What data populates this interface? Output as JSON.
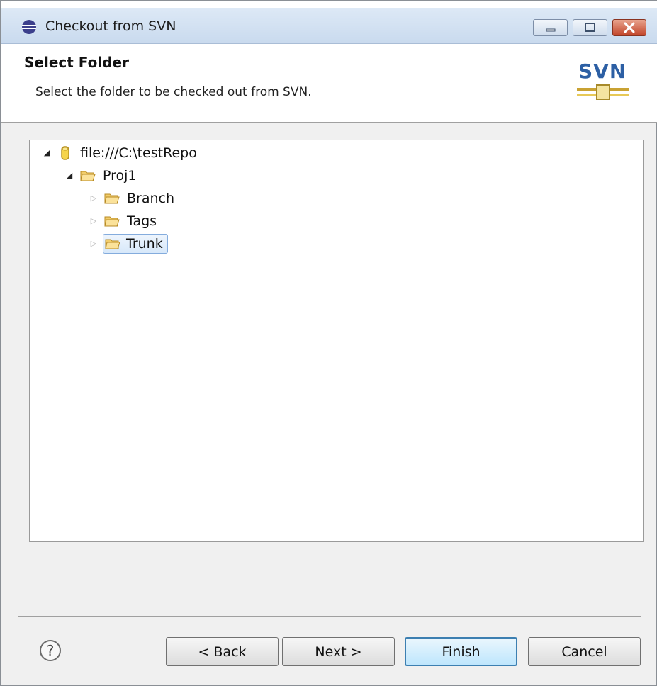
{
  "window": {
    "title": "Checkout from SVN",
    "controls": {
      "minimize_icon": "minimize-icon",
      "maximize_icon": "maximize-icon",
      "close_icon": "close-icon"
    }
  },
  "header": {
    "title": "Select Folder",
    "description": "Select the folder to be checked out from SVN.",
    "logo_text": "SVN"
  },
  "tree": {
    "root": {
      "label": "file:///C:\\testRepo",
      "expanded": true,
      "icon": "repository-icon"
    },
    "project": {
      "label": "Proj1",
      "expanded": true,
      "icon": "folder-icon"
    },
    "children": [
      {
        "label": "Branch",
        "expanded": false,
        "selected": false,
        "icon": "folder-icon"
      },
      {
        "label": "Tags",
        "expanded": false,
        "selected": false,
        "icon": "folder-icon"
      },
      {
        "label": "Trunk",
        "expanded": false,
        "selected": true,
        "icon": "folder-icon"
      }
    ]
  },
  "buttons": {
    "back": "< Back",
    "next": "Next >",
    "finish": "Finish",
    "cancel": "Cancel",
    "help_icon": "help-icon"
  },
  "colors": {
    "selection_border": "#84acdd",
    "default_button_border": "#3c7fb1",
    "svn_blue": "#2c5fa4"
  }
}
